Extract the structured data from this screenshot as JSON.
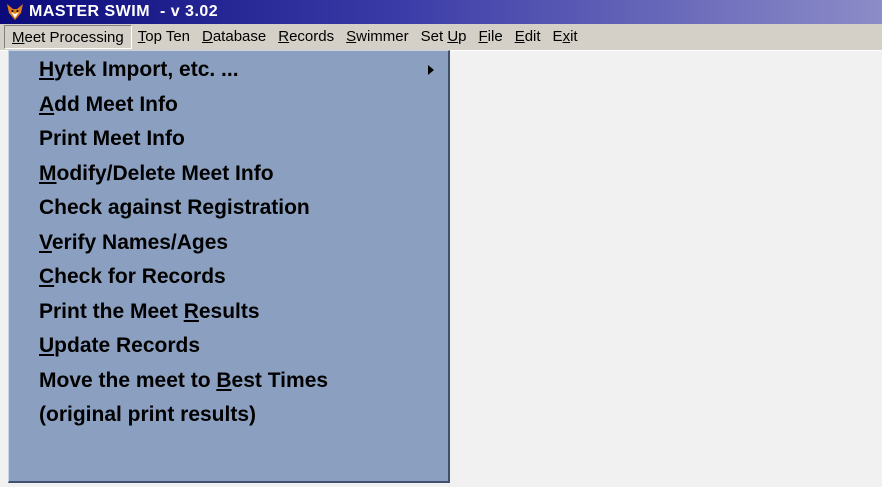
{
  "window": {
    "title": "MASTER SWIM  - v 3.02",
    "icon": "fox-app-icon"
  },
  "menubar": {
    "items": [
      {
        "pre": "",
        "u": "M",
        "post": "eet Processing"
      },
      {
        "pre": "",
        "u": "T",
        "post": "op Ten"
      },
      {
        "pre": "",
        "u": "D",
        "post": "atabase"
      },
      {
        "pre": "",
        "u": "R",
        "post": "ecords"
      },
      {
        "pre": "",
        "u": "S",
        "post": "wimmer"
      },
      {
        "pre": "Set ",
        "u": "U",
        "post": "p"
      },
      {
        "pre": "",
        "u": "F",
        "post": "ile"
      },
      {
        "pre": "",
        "u": "E",
        "post": "dit"
      },
      {
        "pre": "E",
        "u": "x",
        "post": "it"
      }
    ]
  },
  "dropdown": {
    "items": [
      {
        "pre": "",
        "u": "H",
        "post": "ytek Import, etc. ...",
        "submenu": true
      },
      {
        "pre": "",
        "u": "A",
        "post": "dd Meet Info"
      },
      {
        "pre": "Print Meet Info",
        "u": "",
        "post": ""
      },
      {
        "pre": "",
        "u": "M",
        "post": "odify/Delete Meet Info"
      },
      {
        "pre": "Check against Registration",
        "u": "",
        "post": ""
      },
      {
        "pre": "",
        "u": "V",
        "post": "erify Names/Ages"
      },
      {
        "pre": "",
        "u": "C",
        "post": "heck for Records"
      },
      {
        "pre": "Print the Meet ",
        "u": "R",
        "post": "esults"
      },
      {
        "pre": "",
        "u": "U",
        "post": "pdate Records"
      },
      {
        "pre": "Move the meet to ",
        "u": "B",
        "post": "est Times"
      },
      {
        "pre": "(original print results)",
        "u": "",
        "post": ""
      }
    ]
  },
  "colors": {
    "titlebar_start": "#0a0a7a",
    "menubar": "#d4d0c8",
    "dropdown": "#8ba0c0",
    "workspace": "#f1f1f1"
  }
}
